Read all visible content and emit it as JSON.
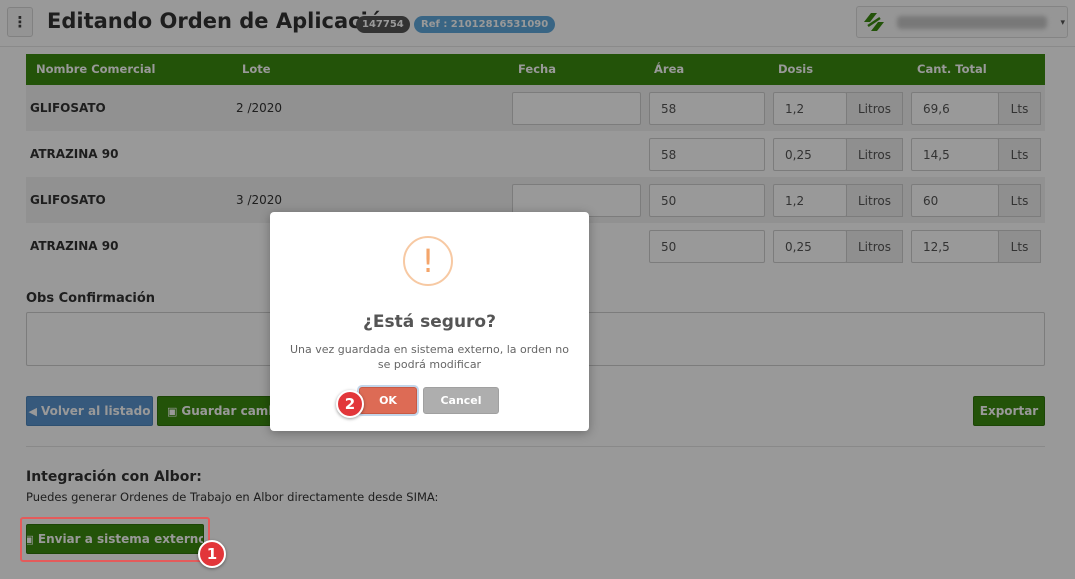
{
  "header": {
    "menu_icon": "⋮",
    "title": "Editando Orden de Aplicación",
    "order_id": "147754",
    "ref": "Ref : 21012816531090",
    "user_caret": "▾"
  },
  "table": {
    "columns": [
      "Nombre Comercial",
      "Lote",
      "Fecha",
      "Área",
      "Dosis",
      "Cant. Total"
    ],
    "rows": [
      {
        "nombre": "GLIFOSATO",
        "lote": "2 /2020",
        "area": "58",
        "dosis": "1,2",
        "dosis_unit": "Litros",
        "total": "69,6",
        "total_unit": "Lts"
      },
      {
        "nombre": "ATRAZINA 90",
        "lote": "",
        "area": "58",
        "dosis": "0,25",
        "dosis_unit": "Litros",
        "total": "14,5",
        "total_unit": "Lts"
      },
      {
        "nombre": "GLIFOSATO",
        "lote": "3 /2020",
        "area": "50",
        "dosis": "1,2",
        "dosis_unit": "Litros",
        "total": "60",
        "total_unit": "Lts"
      },
      {
        "nombre": "ATRAZINA 90",
        "lote": "",
        "area": "50",
        "dosis": "0,25",
        "dosis_unit": "Litros",
        "total": "12,5",
        "total_unit": "Lts"
      }
    ]
  },
  "obs": {
    "label": "Obs Confirmación",
    "value": ""
  },
  "actions": {
    "back": "Volver al listado",
    "save": "Guardar cambios",
    "export": "Exportar"
  },
  "integration": {
    "title": "Integración con Albor:",
    "description": "Puedes generar Ordenes de Trabajo en Albor directamente desde SIMA:",
    "send_button": "Enviar a sistema externo"
  },
  "modal": {
    "icon": "!",
    "title": "¿Está seguro?",
    "text": "Una vez guardada en sistema externo, la orden no se podrá modificar",
    "ok": "OK",
    "cancel": "Cancel"
  },
  "steps": {
    "one": "1",
    "two": "2"
  },
  "colors": {
    "green": "#3b8a0f",
    "blue": "#5b95cf",
    "ok": "#dd6b55",
    "badge_ref": "#5fa9dd",
    "step": "#e2363a"
  }
}
